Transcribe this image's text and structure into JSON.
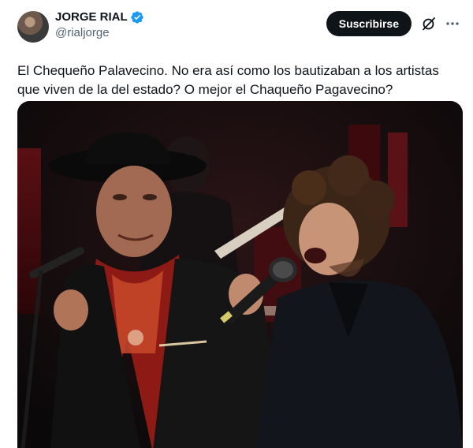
{
  "author": {
    "display_name": "JORGE RIAL",
    "handle": "@rialjorge",
    "verified_icon": "verified-badge-icon"
  },
  "actions": {
    "subscribe_label": "Suscribirse",
    "grok_icon": "grok-icon",
    "more_icon": "more-options-icon"
  },
  "tweet": {
    "text": "El Chequeño Palavecino. No era así como los bautizaban a los artistas que viven de la del estado? O mejor el Chaqueño Pagavecino?"
  },
  "media": {
    "type": "photo",
    "subject": "photo-two-men-singing-on-stage"
  },
  "colors": {
    "text_primary": "#0f1419",
    "text_secondary": "#536471",
    "verified_blue": "#1d9bf0",
    "button_bg": "#0f1419",
    "button_text": "#ffffff"
  }
}
